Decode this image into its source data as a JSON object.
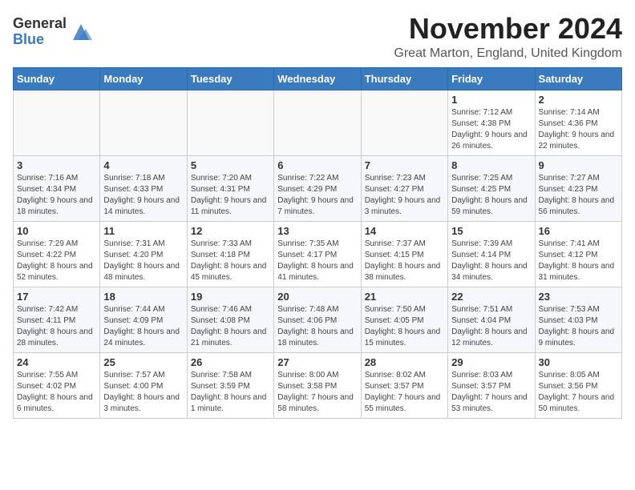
{
  "logo": {
    "general": "General",
    "blue": "Blue"
  },
  "header": {
    "month": "November 2024",
    "location": "Great Marton, England, United Kingdom"
  },
  "days_of_week": [
    "Sunday",
    "Monday",
    "Tuesday",
    "Wednesday",
    "Thursday",
    "Friday",
    "Saturday"
  ],
  "weeks": [
    [
      {
        "day": "",
        "info": ""
      },
      {
        "day": "",
        "info": ""
      },
      {
        "day": "",
        "info": ""
      },
      {
        "day": "",
        "info": ""
      },
      {
        "day": "",
        "info": ""
      },
      {
        "day": "1",
        "info": "Sunrise: 7:12 AM\nSunset: 4:38 PM\nDaylight: 9 hours and 26 minutes."
      },
      {
        "day": "2",
        "info": "Sunrise: 7:14 AM\nSunset: 4:36 PM\nDaylight: 9 hours and 22 minutes."
      }
    ],
    [
      {
        "day": "3",
        "info": "Sunrise: 7:16 AM\nSunset: 4:34 PM\nDaylight: 9 hours and 18 minutes."
      },
      {
        "day": "4",
        "info": "Sunrise: 7:18 AM\nSunset: 4:33 PM\nDaylight: 9 hours and 14 minutes."
      },
      {
        "day": "5",
        "info": "Sunrise: 7:20 AM\nSunset: 4:31 PM\nDaylight: 9 hours and 11 minutes."
      },
      {
        "day": "6",
        "info": "Sunrise: 7:22 AM\nSunset: 4:29 PM\nDaylight: 9 hours and 7 minutes."
      },
      {
        "day": "7",
        "info": "Sunrise: 7:23 AM\nSunset: 4:27 PM\nDaylight: 9 hours and 3 minutes."
      },
      {
        "day": "8",
        "info": "Sunrise: 7:25 AM\nSunset: 4:25 PM\nDaylight: 8 hours and 59 minutes."
      },
      {
        "day": "9",
        "info": "Sunrise: 7:27 AM\nSunset: 4:23 PM\nDaylight: 8 hours and 56 minutes."
      }
    ],
    [
      {
        "day": "10",
        "info": "Sunrise: 7:29 AM\nSunset: 4:22 PM\nDaylight: 8 hours and 52 minutes."
      },
      {
        "day": "11",
        "info": "Sunrise: 7:31 AM\nSunset: 4:20 PM\nDaylight: 8 hours and 48 minutes."
      },
      {
        "day": "12",
        "info": "Sunrise: 7:33 AM\nSunset: 4:18 PM\nDaylight: 8 hours and 45 minutes."
      },
      {
        "day": "13",
        "info": "Sunrise: 7:35 AM\nSunset: 4:17 PM\nDaylight: 8 hours and 41 minutes."
      },
      {
        "day": "14",
        "info": "Sunrise: 7:37 AM\nSunset: 4:15 PM\nDaylight: 8 hours and 38 minutes."
      },
      {
        "day": "15",
        "info": "Sunrise: 7:39 AM\nSunset: 4:14 PM\nDaylight: 8 hours and 34 minutes."
      },
      {
        "day": "16",
        "info": "Sunrise: 7:41 AM\nSunset: 4:12 PM\nDaylight: 8 hours and 31 minutes."
      }
    ],
    [
      {
        "day": "17",
        "info": "Sunrise: 7:42 AM\nSunset: 4:11 PM\nDaylight: 8 hours and 28 minutes."
      },
      {
        "day": "18",
        "info": "Sunrise: 7:44 AM\nSunset: 4:09 PM\nDaylight: 8 hours and 24 minutes."
      },
      {
        "day": "19",
        "info": "Sunrise: 7:46 AM\nSunset: 4:08 PM\nDaylight: 8 hours and 21 minutes."
      },
      {
        "day": "20",
        "info": "Sunrise: 7:48 AM\nSunset: 4:06 PM\nDaylight: 8 hours and 18 minutes."
      },
      {
        "day": "21",
        "info": "Sunrise: 7:50 AM\nSunset: 4:05 PM\nDaylight: 8 hours and 15 minutes."
      },
      {
        "day": "22",
        "info": "Sunrise: 7:51 AM\nSunset: 4:04 PM\nDaylight: 8 hours and 12 minutes."
      },
      {
        "day": "23",
        "info": "Sunrise: 7:53 AM\nSunset: 4:03 PM\nDaylight: 8 hours and 9 minutes."
      }
    ],
    [
      {
        "day": "24",
        "info": "Sunrise: 7:55 AM\nSunset: 4:02 PM\nDaylight: 8 hours and 6 minutes."
      },
      {
        "day": "25",
        "info": "Sunrise: 7:57 AM\nSunset: 4:00 PM\nDaylight: 8 hours and 3 minutes."
      },
      {
        "day": "26",
        "info": "Sunrise: 7:58 AM\nSunset: 3:59 PM\nDaylight: 8 hours and 1 minute."
      },
      {
        "day": "27",
        "info": "Sunrise: 8:00 AM\nSunset: 3:58 PM\nDaylight: 7 hours and 58 minutes."
      },
      {
        "day": "28",
        "info": "Sunrise: 8:02 AM\nSunset: 3:57 PM\nDaylight: 7 hours and 55 minutes."
      },
      {
        "day": "29",
        "info": "Sunrise: 8:03 AM\nSunset: 3:57 PM\nDaylight: 7 hours and 53 minutes."
      },
      {
        "day": "30",
        "info": "Sunrise: 8:05 AM\nSunset: 3:56 PM\nDaylight: 7 hours and 50 minutes."
      }
    ]
  ]
}
